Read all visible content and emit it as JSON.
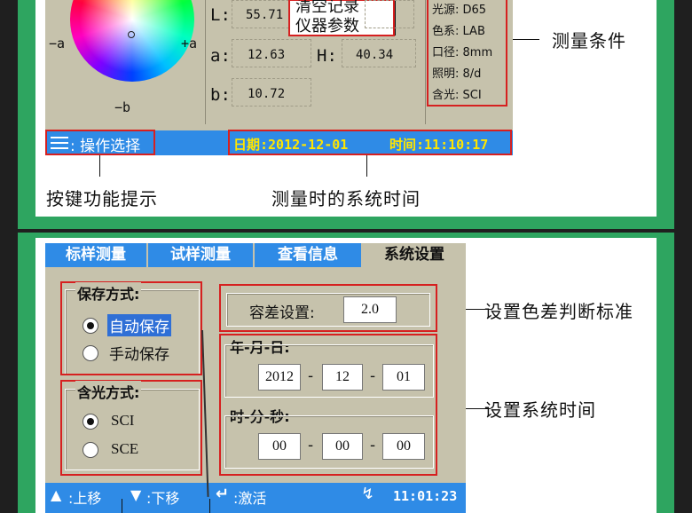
{
  "top": {
    "axis_labels": {
      "neg_a": "−a",
      "pos_a": "+a",
      "neg_b": "−b"
    },
    "menu_items": [
      "清空记录",
      "仪器参数"
    ],
    "L_label": "L:",
    "L_value": "55.71",
    "a_label": "a:",
    "a_value": "12.63",
    "H_label": "H:",
    "H_value": "40.34",
    "b_label": "b:",
    "b_value": "10.72",
    "conditions": [
      "光源: D65",
      "色系: LAB",
      "口径: 8mm",
      "照明: 8/d",
      "含光: SCI"
    ],
    "status_left": ": 操作选择",
    "date_text": "日期:2012-12-01",
    "time_text": "时间:11:10:17",
    "annot_conditions": "测量条件",
    "annot_keys": "按键功能提示",
    "annot_time": "测量时的系统时间"
  },
  "bottom": {
    "tabs": [
      "标样测量",
      "试样测量",
      "查看信息",
      "系统设置"
    ],
    "save_title": "保存方式:",
    "save_auto": "自动保存",
    "save_manual": "手动保存",
    "gloss_title": "含光方式:",
    "gloss_sci": "SCI",
    "gloss_sce": "SCE",
    "tolerance_label": "容差设置:",
    "tolerance_value": "2.0",
    "date_title": "年-月-日:",
    "year": "2012",
    "month": "12",
    "day": "01",
    "time_title": "时-分-秒:",
    "hour": "00",
    "minute": "00",
    "second": "00",
    "dash": "-",
    "hint_up": ":上移",
    "hint_down": ":下移",
    "hint_enter": ":激活",
    "clock": "11:01:23",
    "annot_tolerance": "设置色差判断标准",
    "annot_systime": "设置系统时间"
  },
  "colors": {
    "frame_green": "#2ea560",
    "lcd_bg": "#c6c2ac",
    "status_blue": "#2f8be6",
    "highlight_red": "#d62020",
    "status_yellow": "#ffe600"
  }
}
